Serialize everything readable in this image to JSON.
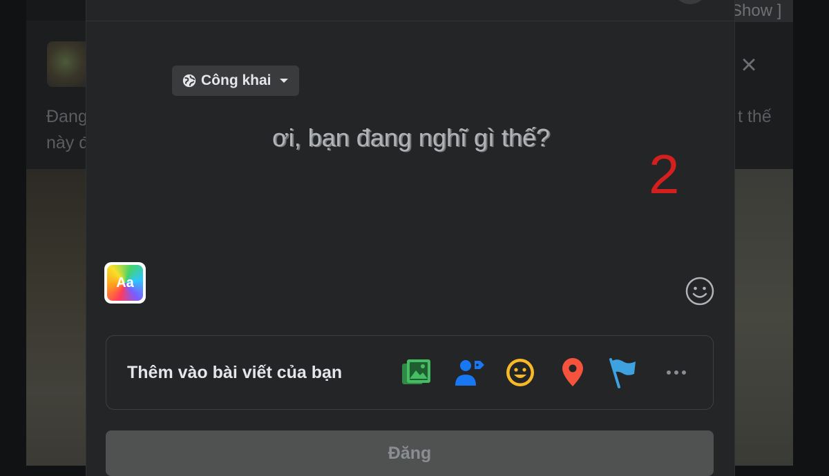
{
  "background": {
    "show_link": "Show ]",
    "post_text_left": "Đang\nnày đ",
    "post_text_right": "t thế"
  },
  "modal": {
    "audience": {
      "label": "Công khai",
      "icon": "globe-icon"
    },
    "composer": {
      "placeholder": "ơi, bạn đang nghĩ gì thế?"
    },
    "annotation": "2",
    "text_style_button": "Aa",
    "add_to_post": {
      "label": "Thêm vào bài viết của bạn",
      "icons": [
        "photo-video-icon",
        "tag-people-icon",
        "feeling-activity-icon",
        "check-in-icon",
        "life-event-flag-icon",
        "more-icon"
      ]
    },
    "post_button": "Đăng"
  },
  "colors": {
    "modal_bg": "#242526",
    "annotation": "#d41f1f",
    "photo_green": "#45bd62",
    "tag_blue": "#1877f2",
    "feeling_yellow": "#f7b928",
    "checkin_red": "#f5533d",
    "flag_blue": "#3ea2e0"
  }
}
